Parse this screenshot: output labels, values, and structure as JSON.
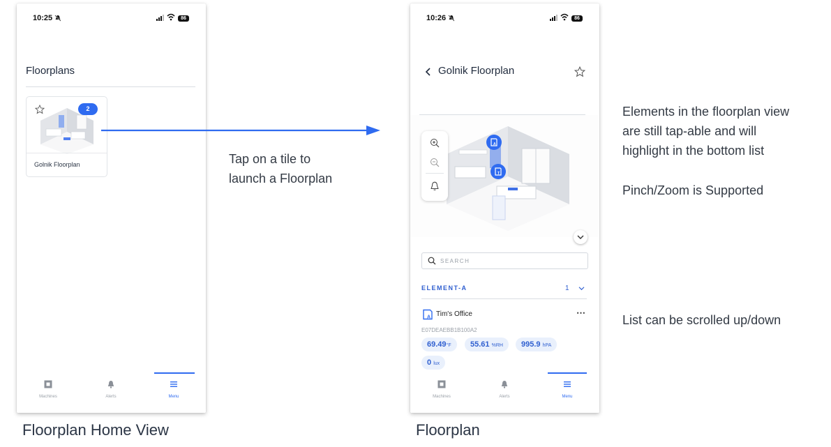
{
  "left_phone": {
    "status": {
      "time": "10:25",
      "battery": "86"
    },
    "title": "Floorplans",
    "tile": {
      "label": "Golnik Floorplan",
      "badge": "2"
    },
    "tabs": [
      {
        "label": "Machines",
        "icon": "machine-icon",
        "active": false
      },
      {
        "label": "Alerts",
        "icon": "bell-icon",
        "active": false
      },
      {
        "label": "Menu",
        "icon": "menu-icon",
        "active": true
      }
    ]
  },
  "right_phone": {
    "status": {
      "time": "10:26",
      "battery": "86"
    },
    "title": "Golnik Floorplan",
    "search": {
      "placeholder": "SEARCH"
    },
    "group": {
      "name": "ELEMENT-A",
      "count": "1"
    },
    "item": {
      "name": "Tim's Office",
      "id": "E07DEAEBB1B100A2",
      "readings": [
        {
          "value": "69.49",
          "unit": "°F"
        },
        {
          "value": "55.61",
          "unit": "%RH"
        },
        {
          "value": "995.9",
          "unit": "hPA"
        },
        {
          "value": "0",
          "unit": "lux"
        }
      ]
    },
    "tabs": [
      {
        "label": "Machines",
        "icon": "machine-icon",
        "active": false
      },
      {
        "label": "Alerts",
        "icon": "bell-icon",
        "active": false
      },
      {
        "label": "Menu",
        "icon": "menu-icon",
        "active": true
      }
    ]
  },
  "annotations": {
    "tap_note": [
      "Tap on a tile to",
      "launch a Floorplan"
    ],
    "elements_note": [
      "Elements in the floorplan view",
      "are still tap-able and will",
      "highlight in the bottom list"
    ],
    "zoom_note": "Pinch/Zoom is Supported",
    "scroll_note": "List can be scrolled up/down"
  },
  "captions": {
    "left": "Floorplan Home View",
    "right": "Floorplan"
  },
  "colors": {
    "accent": "#2f6bf0",
    "pill_bg": "#e9f0fc"
  }
}
